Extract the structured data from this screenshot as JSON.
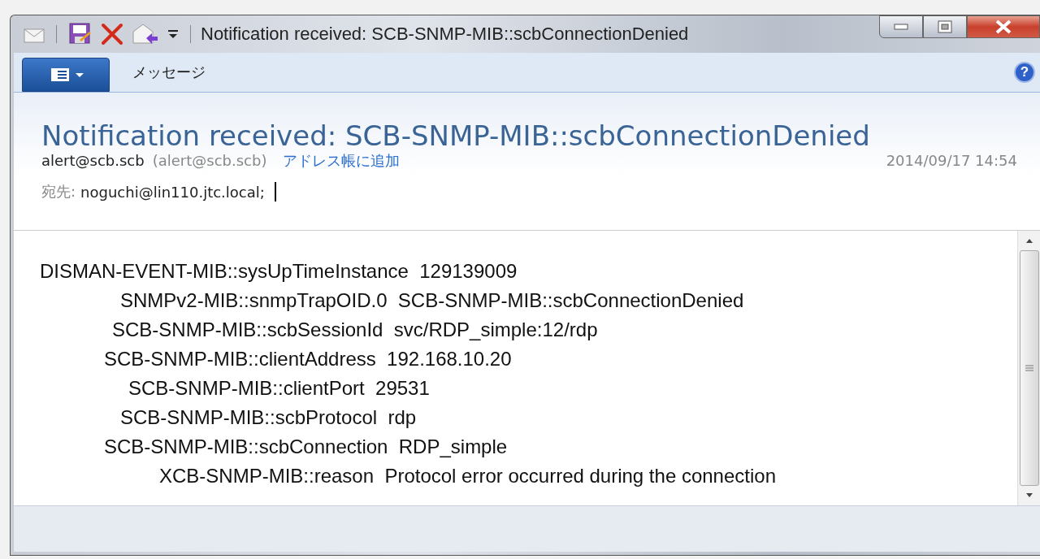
{
  "window": {
    "title": "Notification received: SCB-SNMP-MIB::scbConnectionDenied"
  },
  "ribbon": {
    "tabs": [
      "メッセージ"
    ],
    "help_button": "?"
  },
  "message": {
    "subject": "Notification received: SCB-SNMP-MIB::scbConnectionDenied",
    "sender_name": "alert@scb.scb",
    "sender_address": "(alert@scb.scb)",
    "add_contact_link": "アドレス帳に追加",
    "date": "2014/09/17 14:54",
    "to_label": "宛先:",
    "to": "noguchi@lin110.jtc.local;"
  },
  "body": {
    "lines": [
      "DISMAN-EVENT-MIB::sysUpTimeInstance  129139009",
      "SNMPv2-MIB::snmpTrapOID.0  SCB-SNMP-MIB::scbConnectionDenied",
      "SCB-SNMP-MIB::scbSessionId  svc/RDP_simple:12/rdp",
      "SCB-SNMP-MIB::clientAddress  192.168.10.20",
      "SCB-SNMP-MIB::clientPort  29531",
      "SCB-SNMP-MIB::scbProtocol  rdp",
      "SCB-SNMP-MIB::scbConnection  RDP_simple",
      "XCB-SNMP-MIB::reason  Protocol error occurred during the connection"
    ]
  }
}
